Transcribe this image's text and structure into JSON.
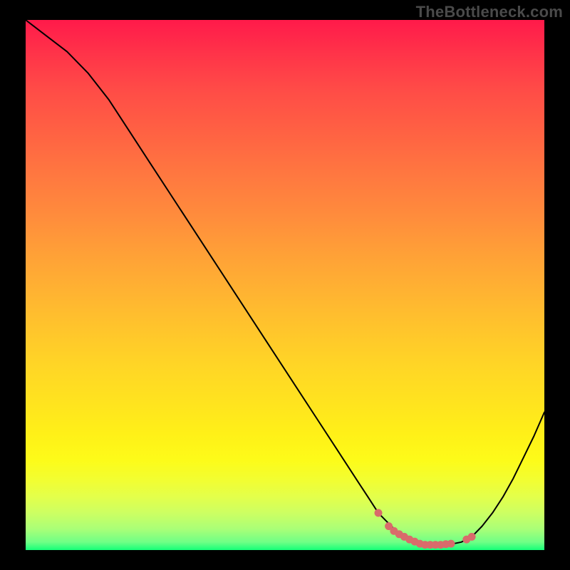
{
  "watermark": "TheBottleneck.com",
  "chart_data": {
    "type": "line",
    "title": "",
    "xlabel": "",
    "ylabel": "",
    "xlim": [
      0,
      100
    ],
    "ylim": [
      0,
      100
    ],
    "grid": false,
    "series": [
      {
        "name": "bottleneck-curve",
        "x": [
          0,
          4,
          8,
          12,
          16,
          20,
          24,
          28,
          32,
          36,
          40,
          44,
          48,
          52,
          56,
          60,
          64,
          66,
          68,
          70,
          72,
          74,
          76,
          78,
          80,
          82,
          84,
          86,
          88,
          90,
          92,
          94,
          96,
          98,
          100
        ],
        "y": [
          100,
          97,
          94,
          90,
          85,
          79,
          73,
          67,
          61,
          55,
          49,
          43,
          37,
          31,
          25,
          19,
          13,
          10,
          7,
          5,
          3,
          2,
          1.2,
          1,
          1,
          1.1,
          1.5,
          2.5,
          4.5,
          7,
          10,
          13.5,
          17.5,
          21.5,
          26
        ]
      }
    ],
    "markers": {
      "name": "highlight-dots",
      "color": "#d96b6b",
      "x": [
        68,
        70,
        71,
        72,
        73,
        74,
        75,
        76,
        77,
        78,
        79,
        80,
        81,
        82,
        85,
        86
      ],
      "y": [
        7,
        4.5,
        3.6,
        3,
        2.5,
        2,
        1.6,
        1.2,
        1,
        1,
        1,
        1,
        1.1,
        1.2,
        2,
        2.5
      ]
    },
    "background_gradient": {
      "stops": [
        {
          "pos": 0.0,
          "color": "#ff1a4a"
        },
        {
          "pos": 0.5,
          "color": "#ffb232"
        },
        {
          "pos": 0.8,
          "color": "#fdfb19"
        },
        {
          "pos": 1.0,
          "color": "#15ff78"
        }
      ]
    }
  }
}
